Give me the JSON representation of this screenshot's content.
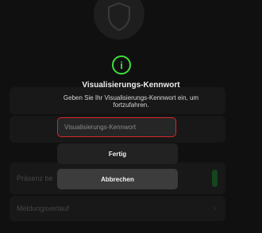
{
  "background": {
    "presence_label": "Präsenz be",
    "history_label": "Meldungsverlauf",
    "toggle_on": true
  },
  "dialog": {
    "icon": "info-icon",
    "title": "Visualisierungs-Kennwort",
    "message": "Geben Sie Ihr Visualisierungs-Kennwort ein, um fortzufahren.",
    "password_placeholder": "Visualisierungs-Kennwort",
    "password_value": "",
    "confirm_label": "Fertig",
    "cancel_label": "Abbrechen"
  },
  "colors": {
    "accent_green": "#3ee03a",
    "error_red": "#d6262a"
  }
}
